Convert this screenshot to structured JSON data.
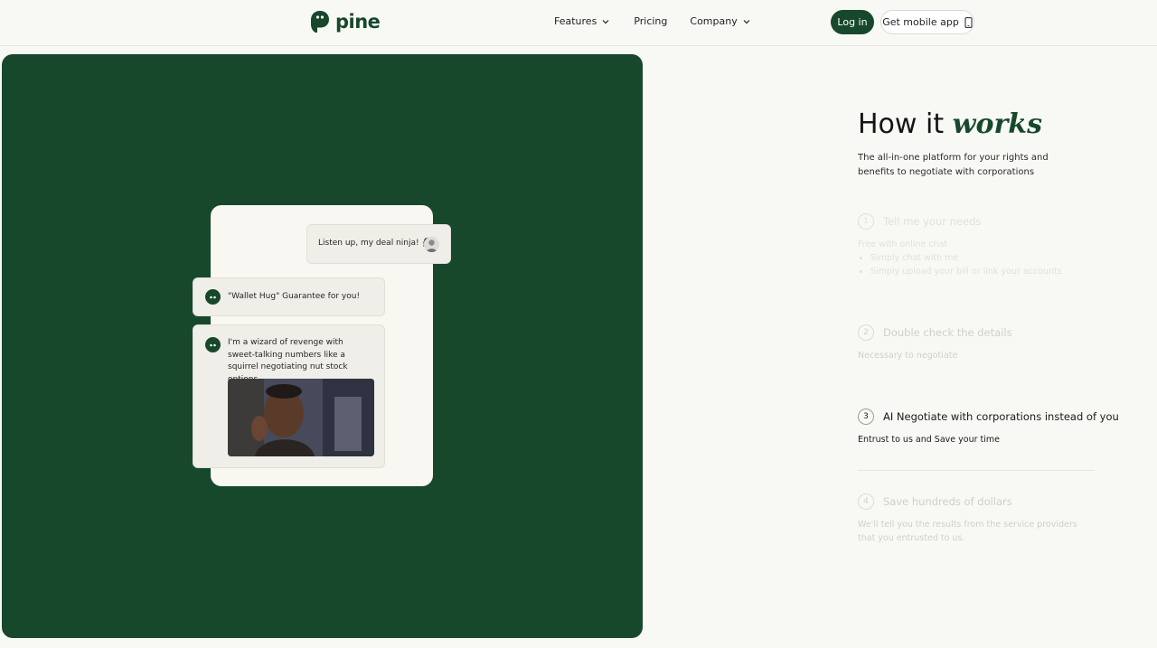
{
  "header": {
    "brand": "pine",
    "nav": [
      {
        "label": "Features",
        "has_dropdown": true
      },
      {
        "label": "Pricing",
        "has_dropdown": false
      },
      {
        "label": "Company",
        "has_dropdown": true
      }
    ],
    "login_label": "Log in",
    "mobile_app_label": "Get mobile app"
  },
  "colors": {
    "brand_green": "#17482b",
    "page_bg": "#f8f8f5",
    "bubble_bg": "#efeee8"
  },
  "chat": {
    "user_message": "Listen up, my deal ninja! 🥷",
    "bot_message_1": "\"Wallet Hug\" Guarantee for you!",
    "bot_message_2": "I'm a wizard of revenge with sweet-talking numbers like a squirrel negotiating nut stock options."
  },
  "how_it_works": {
    "title_plain": "How it",
    "title_emphasis": "works",
    "subtitle": "The all-in-one platform for your rights and benefits to negotiate with corporations",
    "steps": [
      {
        "number": "1",
        "title": "Tell me your needs",
        "description": "Free with online chat",
        "bullets": [
          "Simply chat with me",
          "Simply upload your bill or link your accounts"
        ]
      },
      {
        "number": "2",
        "title": "Double check the details",
        "description": "Necessary to negotiate"
      },
      {
        "number": "3",
        "title": "AI Negotiate with corporations instead of you",
        "description": "Entrust to us and Save your time"
      },
      {
        "number": "4",
        "title": "Save hundreds of dollars",
        "description": "We'll tell you the results from the service providers that you entrusted to us."
      }
    ]
  }
}
